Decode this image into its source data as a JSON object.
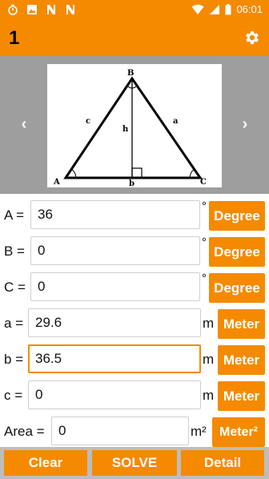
{
  "status_bar": {
    "time": "06:01",
    "left_icons": [
      "timer-icon",
      "image-icon",
      "notification-n-icon",
      "notification-n-icon"
    ]
  },
  "app_bar": {
    "title": "1"
  },
  "diagram": {
    "vertex_a": "A",
    "vertex_b": "B",
    "vertex_c": "C",
    "side_a": "a",
    "side_b": "b",
    "side_c": "c",
    "height": "h"
  },
  "fields": [
    {
      "label": "A =",
      "value": "36",
      "unit": "°",
      "unit_button": "Degree"
    },
    {
      "label": "B =",
      "value": "0",
      "unit": "°",
      "unit_button": "Degree"
    },
    {
      "label": "C =",
      "value": "0",
      "unit": "°",
      "unit_button": "Degree"
    },
    {
      "label": "a =",
      "value": "29.6",
      "unit": "m",
      "unit_button": "Meter"
    },
    {
      "label": "b =",
      "value": "36.5",
      "unit": "m",
      "unit_button": "Meter"
    },
    {
      "label": "c =",
      "value": "0",
      "unit": "m",
      "unit_button": "Meter"
    },
    {
      "label": "Area =",
      "value": "0",
      "unit": "m²",
      "unit_button": "Meter²"
    }
  ],
  "buttons": {
    "clear": "Clear",
    "solve": "SOLVE",
    "detail": "Detail"
  },
  "colors": {
    "accent": "#f58a00",
    "bottom_bar": "#bdbdbd",
    "image_strip": "#9e9e9e"
  }
}
